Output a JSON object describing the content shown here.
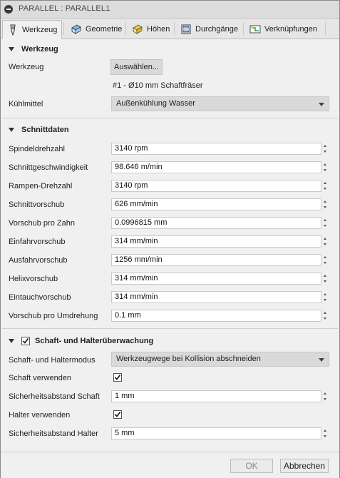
{
  "window": {
    "title": "PARALLEL : PARALLEL1"
  },
  "tabs": [
    {
      "label": "Werkzeug",
      "icon": "tool-icon",
      "active": true
    },
    {
      "label": "Geometrie",
      "icon": "geometry-icon",
      "active": false
    },
    {
      "label": "Höhen",
      "icon": "heights-icon",
      "active": false
    },
    {
      "label": "Durchgänge",
      "icon": "passes-icon",
      "active": false
    },
    {
      "label": "Verknüpfungen",
      "icon": "linking-icon",
      "active": false
    }
  ],
  "werkzeug": {
    "heading": "Werkzeug",
    "tool_label": "Werkzeug",
    "select_button": "Auswählen...",
    "tool_description": "#1 - Ø10 mm Schaftfräser",
    "coolant_label": "Kühlmittel",
    "coolant_value": "Außenkühlung Wasser"
  },
  "schnittdaten": {
    "heading": "Schnittdaten",
    "fields": [
      {
        "label": "Spindeldrehzahl",
        "value": "3140 rpm"
      },
      {
        "label": "Schnittgeschwindigkeit",
        "value": "98.646 m/min"
      },
      {
        "label": "Rampen-Drehzahl",
        "value": "3140 rpm"
      },
      {
        "label": "Schnittvorschub",
        "value": "626 mm/min"
      },
      {
        "label": "Vorschub pro Zahn",
        "value": "0.0996815 mm"
      },
      {
        "label": "Einfahrvorschub",
        "value": "314 mm/min"
      },
      {
        "label": "Ausfahrvorschub",
        "value": "1256 mm/min"
      },
      {
        "label": "Helixvorschub",
        "value": "314 mm/min"
      },
      {
        "label": "Eintauchvorschub",
        "value": "314 mm/min"
      },
      {
        "label": "Vorschub pro Umdrehung",
        "value": "0.1 mm"
      }
    ]
  },
  "schaft": {
    "heading": "Schaft- und Halterüberwachung",
    "enabled": true,
    "mode_label": "Schaft- und Haltermodus",
    "mode_value": "Werkzeugwege bei Kollision abschneiden",
    "use_shaft_label": "Schaft verwenden",
    "use_shaft": true,
    "shaft_clearance_label": "Sicherheitsabstand Schaft",
    "shaft_clearance_value": "1 mm",
    "use_holder_label": "Halter verwenden",
    "use_holder": true,
    "holder_clearance_label": "Sicherheitsabstand Halter",
    "holder_clearance_value": "5 mm"
  },
  "footer": {
    "ok": "OK",
    "cancel": "Abbrechen"
  }
}
